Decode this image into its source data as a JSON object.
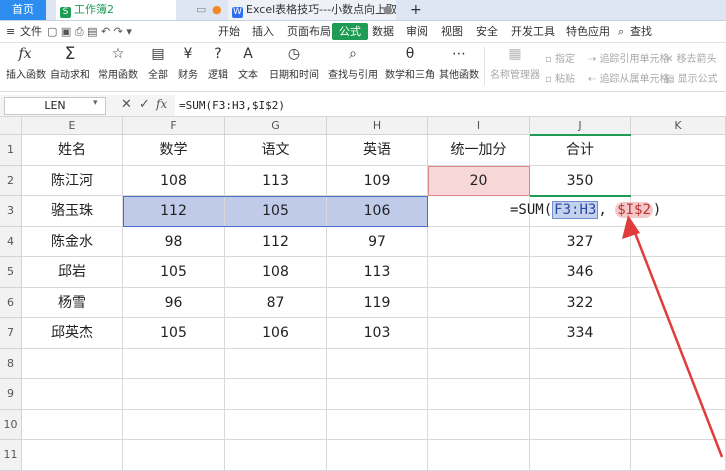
{
  "tabs": {
    "home": "首页",
    "workbook": "工作簿2",
    "doc": "Excel表格技巧---小数点向上取整",
    "add": "+"
  },
  "menu": {
    "file": "文件",
    "items": [
      "开始",
      "插入",
      "页面布局",
      "公式",
      "数据",
      "审阅",
      "视图",
      "安全",
      "开发工具",
      "特色应用"
    ],
    "search": "查找"
  },
  "ribbon": {
    "buttons": [
      {
        "label": "插入函数",
        "icon": "fx-icon",
        "glyph": "fx"
      },
      {
        "label": "自动求和",
        "icon": "sum-icon",
        "glyph": "Σ"
      },
      {
        "label": "常用函数",
        "icon": "star-function-icon",
        "glyph": "☆"
      },
      {
        "label": "全部",
        "icon": "all-functions-icon",
        "glyph": "▤"
      },
      {
        "label": "财务",
        "icon": "finance-icon",
        "glyph": "¥"
      },
      {
        "label": "逻辑",
        "icon": "logic-icon",
        "glyph": "?"
      },
      {
        "label": "文本",
        "icon": "text-icon",
        "glyph": "A"
      },
      {
        "label": "日期和时间",
        "icon": "clock-icon",
        "glyph": "◷"
      },
      {
        "label": "查找与引用",
        "icon": "lookup-icon",
        "glyph": "⌕"
      },
      {
        "label": "数学和三角",
        "icon": "math-icon",
        "glyph": "θ"
      },
      {
        "label": "其他函数",
        "icon": "more-functions-icon",
        "glyph": "⋯"
      }
    ],
    "disabled": [
      {
        "label": "名称管理器",
        "icon": "name-manager-icon",
        "glyph": "▦"
      },
      {
        "label": "指定",
        "icon": "assign-icon"
      },
      {
        "label": "粘贴",
        "icon": "paste-icon"
      },
      {
        "label": "追踪引用单元格",
        "icon": "trace-precedents-icon"
      },
      {
        "label": "追踪从属单元格",
        "icon": "trace-dependents-icon"
      },
      {
        "label": "移去箭头",
        "icon": "remove-arrows-icon"
      },
      {
        "label": "显示公式",
        "icon": "show-formula-icon"
      }
    ]
  },
  "formula_bar": {
    "name_box": "LEN",
    "cancel": "✕",
    "confirm": "✓",
    "fx": "fx",
    "formula": "=SUM(F3:H3,$I$2)"
  },
  "columns": [
    "E",
    "F",
    "G",
    "H",
    "I",
    "J",
    "K"
  ],
  "rows": [
    "1",
    "2",
    "3",
    "4",
    "5",
    "6",
    "7",
    "8",
    "9",
    "10",
    "11"
  ],
  "table": {
    "headers": [
      "姓名",
      "数学",
      "语文",
      "英语",
      "统一加分",
      "合计"
    ],
    "data": [
      [
        "陈江河",
        "108",
        "113",
        "109",
        "20",
        "350"
      ],
      [
        "骆玉珠",
        "112",
        "105",
        "106",
        "",
        ""
      ],
      [
        "陈金水",
        "98",
        "112",
        "97",
        "",
        "327"
      ],
      [
        "邱岩",
        "105",
        "108",
        "113",
        "",
        "346"
      ],
      [
        "杨雪",
        "96",
        "87",
        "119",
        "",
        "322"
      ],
      [
        "邱英杰",
        "105",
        "106",
        "103",
        "",
        "334"
      ]
    ]
  },
  "editing": {
    "prefix": "=SUM(",
    "ref1": "F3:H3",
    "comma": ",",
    "ref2": "$I$2",
    "suffix": ")"
  },
  "colors": {
    "accent": "#1e9c54",
    "selection": "#bfcbe9",
    "highlight": "#f7d7d7",
    "arrow": "#e03c3c"
  }
}
